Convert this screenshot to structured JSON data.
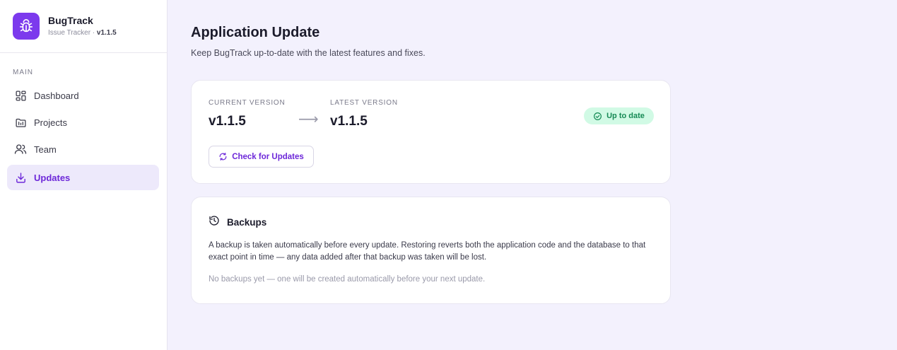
{
  "app": {
    "name": "BugTrack",
    "subtitle": "Issue Tracker · ",
    "version": "v1.1.5",
    "logo_icon": "bug-icon",
    "accent": "#7c3aed"
  },
  "sidebar": {
    "section_label": "MAIN",
    "items": [
      {
        "label": "Dashboard",
        "icon": "dashboard-icon",
        "active": false
      },
      {
        "label": "Projects",
        "icon": "projects-icon",
        "active": false
      },
      {
        "label": "Team",
        "icon": "team-icon",
        "active": false
      },
      {
        "label": "Updates",
        "icon": "download-icon",
        "active": true
      }
    ]
  },
  "page": {
    "title": "Application Update",
    "subtitle": "Keep BugTrack up-to-date with the latest features and fixes."
  },
  "version_card": {
    "current_label": "CURRENT VERSION",
    "current_value": "v1.1.5",
    "arrow": "⟶",
    "latest_label": "LATEST VERSION",
    "latest_value": "v1.1.5",
    "check_button": "Check for Updates",
    "status_badge": "Up to date",
    "status_color": "#168a55"
  },
  "backups_card": {
    "title": "Backups",
    "description": "A backup is taken automatically before every update. Restoring reverts both the application code and the database to that exact point in time — any data added after that backup was taken will be lost.",
    "empty_text": "No backups yet — one will be created automatically before your next update."
  }
}
